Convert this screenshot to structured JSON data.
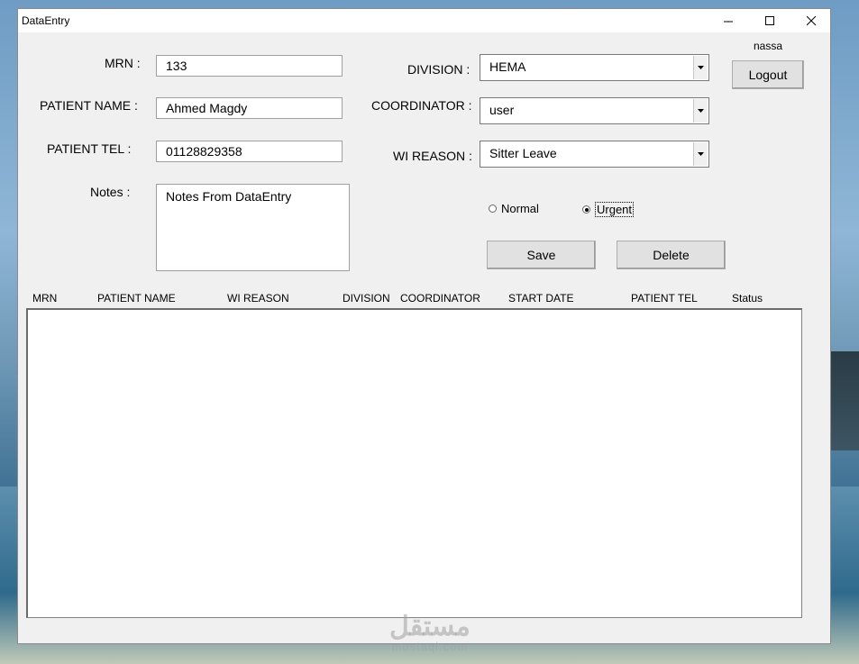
{
  "window": {
    "title": "DataEntry"
  },
  "user": {
    "name": "nassa",
    "logout_label": "Logout"
  },
  "form": {
    "mrn_label": "MRN :",
    "mrn_value": "133",
    "patient_name_label": "PATIENT NAME :",
    "patient_name_value": "Ahmed Magdy",
    "patient_tel_label": "PATIENT TEL :",
    "patient_tel_value": "01128829358",
    "notes_label": "Notes :",
    "notes_value": "Notes From DataEntry",
    "division_label": "DIVISION :",
    "division_value": "HEMA",
    "coordinator_label": "COORDINATOR :",
    "coordinator_value": "user",
    "wi_reason_label": "WI REASON :",
    "wi_reason_value": "Sitter Leave",
    "priority": {
      "options": [
        "Normal",
        "Urgent"
      ],
      "selected": "Urgent"
    },
    "save_label": "Save",
    "delete_label": "Delete"
  },
  "table": {
    "columns": [
      "MRN",
      "PATIENT NAME",
      "WI REASON",
      "DIVISION",
      "COORDINATOR",
      "START DATE",
      "PATIENT TEL",
      "Status"
    ],
    "rows": []
  },
  "watermark": {
    "arabic": "مستقل",
    "latin": "mostaql.com"
  },
  "icons": {
    "minimize": "minimize-icon",
    "maximize": "maximize-icon",
    "close": "close-icon",
    "dropdown": "chevron-down-icon"
  }
}
